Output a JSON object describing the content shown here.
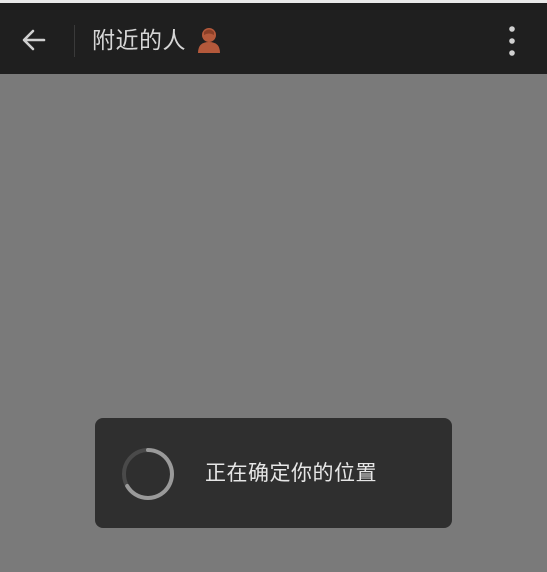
{
  "header": {
    "title": "附近的人",
    "back_icon": "arrow-left-icon",
    "title_icon": "person-avatar-icon",
    "more_icon": "more-vertical-icon"
  },
  "toast": {
    "message": "正在确定你的位置",
    "icon": "loading-spinner-icon"
  },
  "colors": {
    "header_bg": "#1f1f1f",
    "content_bg": "#7a7a7a",
    "toast_bg": "#2f2f2f",
    "title_text": "#d6d6d6",
    "title_icon": "#b4593b"
  }
}
